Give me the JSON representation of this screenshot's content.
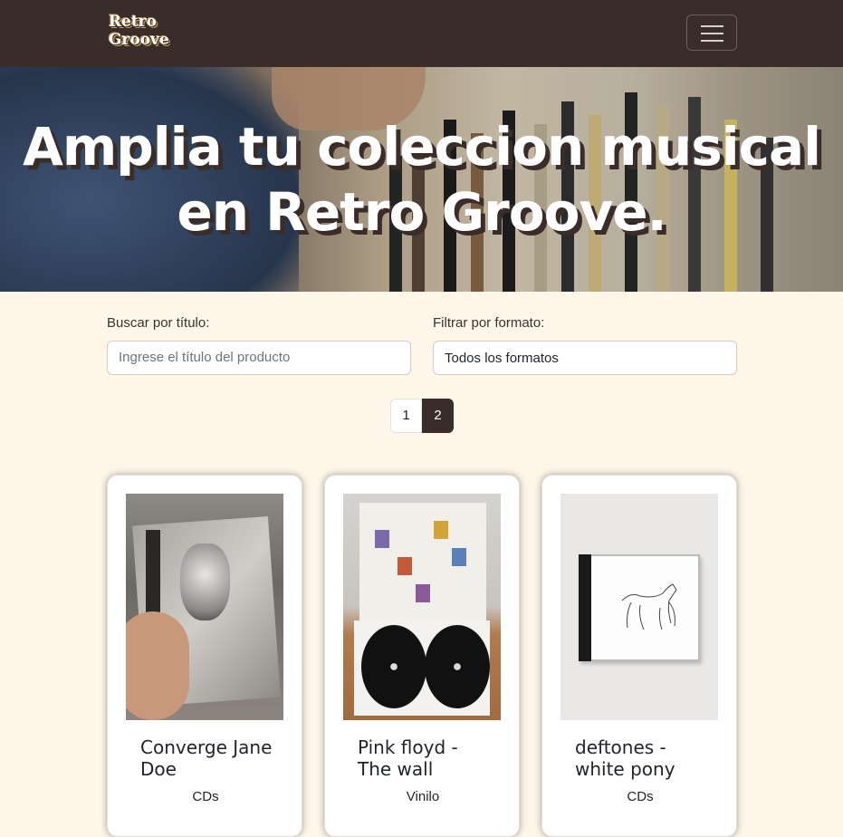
{
  "brand": {
    "logo_line1": "Retro",
    "logo_line2": "Groove"
  },
  "hero": {
    "headline": "Amplia tu coleccion musical en Retro Groove."
  },
  "filters": {
    "search_label": "Buscar por título:",
    "search_placeholder": "Ingrese el título del producto",
    "search_value": "",
    "format_label": "Filtrar por formato:",
    "format_selected": "Todos los formatos"
  },
  "pagination": {
    "pages": [
      "1",
      "2"
    ],
    "active_page": "2"
  },
  "products": [
    {
      "title": "Converge Jane Doe",
      "format": "CDs"
    },
    {
      "title": "Pink floyd - The wall",
      "format": "Vinilo"
    },
    {
      "title": "deftones - white pony",
      "format": "CDs"
    }
  ],
  "colors": {
    "navbar": "#3a2c28",
    "background": "#fdf6e9",
    "accent": "#3a2c28"
  }
}
